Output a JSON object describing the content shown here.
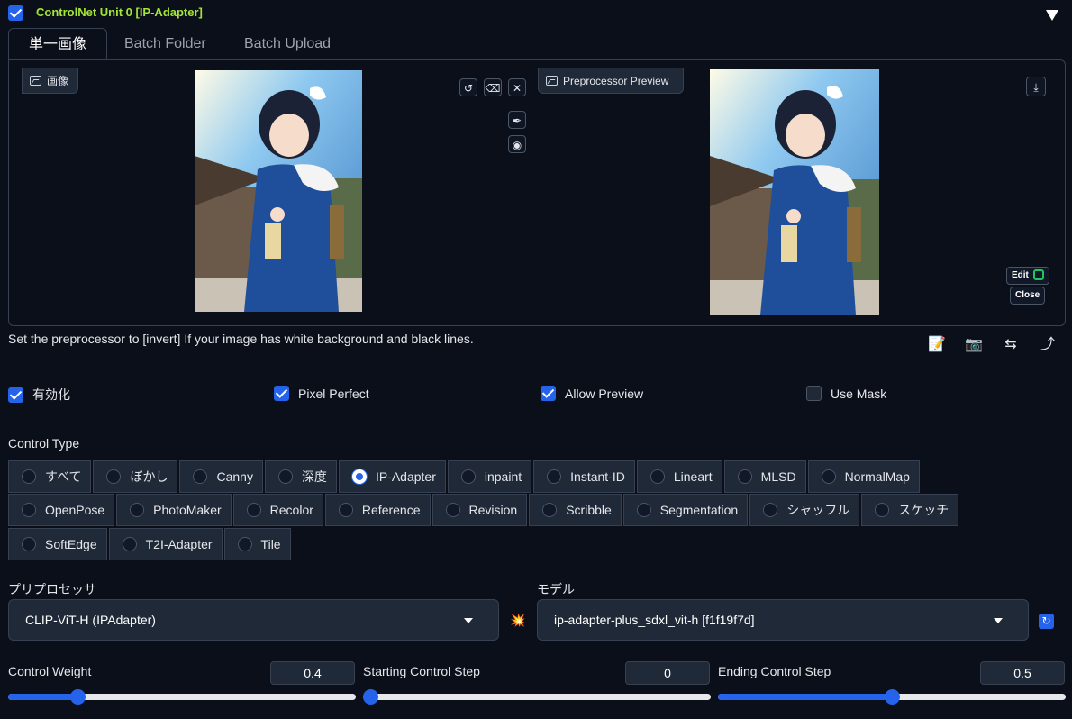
{
  "header": {
    "enabled": true,
    "title": "ControlNet Unit 0  [IP-Adapter]"
  },
  "tabs": [
    {
      "label": "単一画像",
      "active": true
    },
    {
      "label": "Batch Folder",
      "active": false
    },
    {
      "label": "Batch Upload",
      "active": false
    }
  ],
  "image_panel": {
    "input_label": "画像",
    "preview_label": "Preprocessor Preview",
    "edit_label": "Edit",
    "close_label": "Close"
  },
  "hint": "Set the preprocessor to [invert] If your image has white background and black lines.",
  "options": [
    {
      "label": "有効化",
      "checked": true
    },
    {
      "label": "Pixel Perfect",
      "checked": true
    },
    {
      "label": "Allow Preview",
      "checked": true
    },
    {
      "label": "Use Mask",
      "checked": false
    }
  ],
  "control_type": {
    "label": "Control Type",
    "selected": "IP-Adapter",
    "rows": [
      [
        "すべて",
        "ぼかし",
        "Canny",
        "深度",
        "IP-Adapter",
        "inpaint",
        "Instant-ID",
        "Lineart",
        "MLSD",
        "NormalMap"
      ],
      [
        "OpenPose",
        "PhotoMaker",
        "Recolor",
        "Reference",
        "Revision",
        "Scribble",
        "Segmentation",
        "シャッフル",
        "スケッチ"
      ],
      [
        "SoftEdge",
        "T2I-Adapter",
        "Tile"
      ]
    ]
  },
  "preprocessor": {
    "label": "プリプロセッサ",
    "value": "CLIP-ViT-H (IPAdapter)"
  },
  "model": {
    "label": "モデル",
    "value": "ip-adapter-plus_sdxl_vit-h [f1f19f7d]"
  },
  "sliders": [
    {
      "label": "Control Weight",
      "value": "0.4",
      "fraction": 0.2
    },
    {
      "label": "Starting Control Step",
      "value": "0",
      "fraction": 0.0
    },
    {
      "label": "Ending Control Step",
      "value": "0.5",
      "fraction": 0.5
    }
  ],
  "colors": {
    "accent": "#2563eb",
    "title": "#a3e635",
    "background": "#0b0f19"
  }
}
